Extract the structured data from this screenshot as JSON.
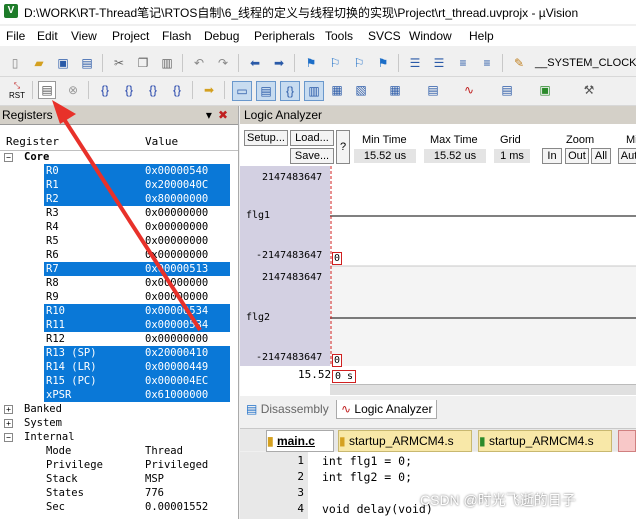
{
  "window": {
    "title": "D:\\WORK\\RT-Thread笔记\\RTOS自制\\6_线程的定义与线程切换的实现\\Project\\rt_thread.uvprojx - µVision"
  },
  "menu": [
    "File",
    "Edit",
    "View",
    "Project",
    "Flash",
    "Debug",
    "Peripherals",
    "Tools",
    "SVCS",
    "Window",
    "Help"
  ],
  "toolbar": {
    "target_label": "__SYSTEM_CLOCK",
    "rst_label": "RST"
  },
  "registers": {
    "title": "Registers",
    "col_register": "Register",
    "col_value": "Value",
    "core_label": "Core",
    "rows": [
      {
        "name": "R0",
        "value": "0x00000540",
        "sel": true
      },
      {
        "name": "R1",
        "value": "0x2000040C",
        "sel": true
      },
      {
        "name": "R2",
        "value": "0x80000000",
        "sel": true
      },
      {
        "name": "R3",
        "value": "0x00000000",
        "sel": false
      },
      {
        "name": "R4",
        "value": "0x00000000",
        "sel": false
      },
      {
        "name": "R5",
        "value": "0x00000000",
        "sel": false
      },
      {
        "name": "R6",
        "value": "0x00000000",
        "sel": false
      },
      {
        "name": "R7",
        "value": "0x00000513",
        "sel": true
      },
      {
        "name": "R8",
        "value": "0x00000000",
        "sel": false
      },
      {
        "name": "R9",
        "value": "0x00000000",
        "sel": false
      },
      {
        "name": "R10",
        "value": "0x00000534",
        "sel": true
      },
      {
        "name": "R11",
        "value": "0x00000534",
        "sel": true
      },
      {
        "name": "R12",
        "value": "0x00000000",
        "sel": false
      },
      {
        "name": "R13 (SP)",
        "value": "0x20000410",
        "sel": true
      },
      {
        "name": "R14 (LR)",
        "value": "0x00000449",
        "sel": true
      },
      {
        "name": "R15 (PC)",
        "value": "0x000004EC",
        "sel": true
      },
      {
        "name": "xPSR",
        "value": "0x61000000",
        "sel": true
      }
    ],
    "groups": [
      "Banked",
      "System",
      "Internal"
    ],
    "internal": [
      {
        "name": "Mode",
        "value": "Thread"
      },
      {
        "name": "Privilege",
        "value": "Privileged"
      },
      {
        "name": "Stack",
        "value": "MSP"
      },
      {
        "name": "States",
        "value": "776"
      },
      {
        "name": "Sec",
        "value": "0.00001552"
      }
    ]
  },
  "logic": {
    "title": "Logic Analyzer",
    "setup": "Setup...",
    "load": "Load...",
    "save": "Save...",
    "help": "?",
    "min_time_label": "Min Time",
    "min_time": "15.52 us",
    "max_time_label": "Max Time",
    "max_time": "15.52 us",
    "grid_label": "Grid",
    "grid": "1 ms",
    "zoom_label": "Zoom",
    "zoom_in": "In",
    "zoom_out": "Out",
    "zoom_all": "All",
    "mi_label": "Mi",
    "auto": "Aut",
    "signals": [
      {
        "name": "flg1",
        "max": "2147483647",
        "min": "-2147483647",
        "mark": "0"
      },
      {
        "name": "flg2",
        "max": "2147483647",
        "min": "-2147483647",
        "mark": "0"
      }
    ],
    "time_value": "15.52",
    "time_mark": "0 s"
  },
  "panel_tabs": [
    "Disassembly",
    "Logic Analyzer"
  ],
  "file_tabs": [
    "main.c",
    "startup_ARMCM4.s",
    "startup_ARMCM4.s"
  ],
  "code_lines": [
    {
      "n": "1",
      "text": "int flg1 = 0;"
    },
    {
      "n": "2",
      "text": "int flg2 = 0;"
    },
    {
      "n": "3",
      "text": ""
    },
    {
      "n": "4",
      "text": "void delay(void)"
    }
  ],
  "watermark": "CSDN @时光飞逝的日子",
  "colors": {
    "selection": "#0a78d7",
    "signal_panel": "#d3d0e2",
    "arrow": "#e8312a",
    "trace": "#000000"
  }
}
